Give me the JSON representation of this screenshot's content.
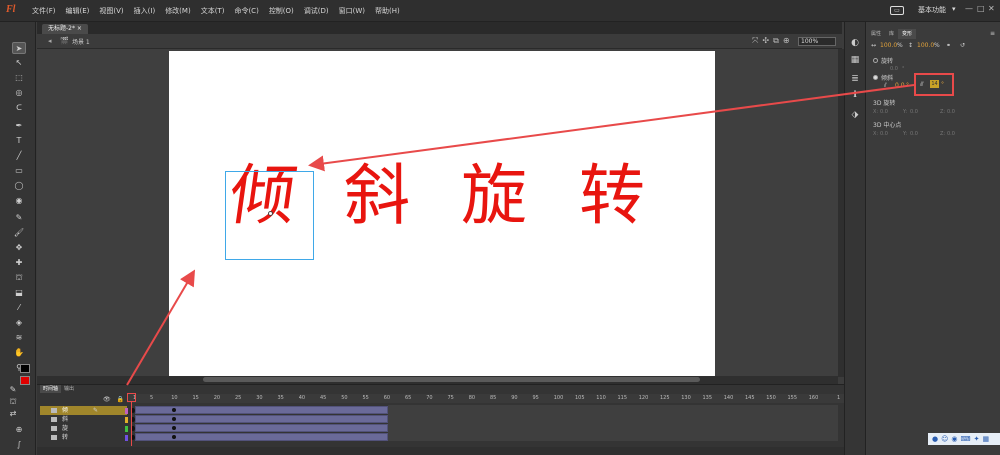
{
  "app": {
    "logo_text": "Fl",
    "menus": [
      "文件(F)",
      "编辑(E)",
      "视图(V)",
      "插入(I)",
      "修改(M)",
      "文本(T)",
      "命令(C)",
      "控制(O)",
      "调试(D)",
      "窗口(W)",
      "帮助(H)"
    ],
    "workspace_icon": "▭",
    "workspace": "基本功能",
    "workspace_arrow": "▾",
    "window_controls": {
      "minimize": "—",
      "maximize": "□",
      "close": "✕"
    }
  },
  "document": {
    "tab_title": "无标题-2*",
    "tab_close": "×",
    "back_icon": "◂",
    "scene_icon": "🎬",
    "scene": "场景 1",
    "zoom": "100%"
  },
  "stage": {
    "chars": [
      "倾",
      "斜",
      "旋",
      "转"
    ],
    "text_color": "#e8150f",
    "selection_color": "#3fa8e8"
  },
  "colors": {
    "stroke": "#000000",
    "fill": "#e00000",
    "annotation": "#e84a4a",
    "accent_value": "#e2a33b"
  },
  "right_panel": {
    "tabs": [
      "属性",
      "库",
      "变形"
    ],
    "menu_icon": "≡",
    "width_value": "100.0",
    "height_value": "100.0",
    "percent": "%",
    "rotate_label": "旋转",
    "rotate_value": "0.0",
    "skew_label": "倾斜",
    "skew_h": "0.0",
    "skew_v": "14",
    "degree": "°",
    "section_3d_rotate": "3D 旋转",
    "section_3d_center": "3D 中心点",
    "axes": {
      "x": "X:",
      "y": "Y:",
      "z": "Z:"
    },
    "rot3d": {
      "x": "0.0",
      "y": "0.0",
      "z": "0.0"
    },
    "center3d": {
      "x": "0.0",
      "y": "0.0",
      "z": "0.0"
    }
  },
  "timeline": {
    "tabs": [
      "时间轴",
      "输出"
    ],
    "ruler": [
      "1",
      "5",
      "10",
      "15",
      "20",
      "25",
      "30",
      "35",
      "40",
      "45",
      "50",
      "55",
      "60",
      "65",
      "70",
      "75",
      "80",
      "85",
      "90",
      "95",
      "100",
      "105",
      "110",
      "115",
      "120",
      "125",
      "130",
      "135",
      "140",
      "145",
      "150",
      "155",
      "160"
    ],
    "ruler_end": "1",
    "layers": [
      {
        "name": "倾",
        "color": "#c060c0",
        "active": true
      },
      {
        "name": "斜",
        "color": "#e0b02a",
        "active": false
      },
      {
        "name": "旋",
        "color": "#40c040",
        "active": false
      },
      {
        "name": "转",
        "color": "#7050e0",
        "active": false
      }
    ]
  }
}
